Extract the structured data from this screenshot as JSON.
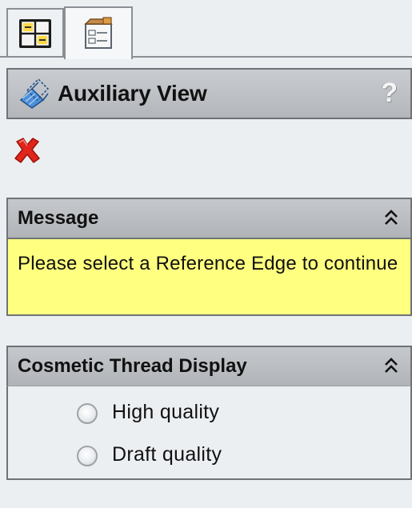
{
  "tabs": [
    {
      "icon": "feature-manager-icon"
    },
    {
      "icon": "property-manager-icon"
    }
  ],
  "property_manager": {
    "title": "Auxiliary View",
    "title_icon": "auxiliary-view-icon",
    "help_label": "?"
  },
  "actions": {
    "close_icon": "close-icon"
  },
  "message_group": {
    "header": "Message",
    "text": "Please select a Reference Edge to continue",
    "background": "#ffff80"
  },
  "cosmetic_thread_group": {
    "header": "Cosmetic Thread Display",
    "options": [
      {
        "label": "High quality",
        "selected": false
      },
      {
        "label": "Draft quality",
        "selected": false
      }
    ]
  },
  "colors": {
    "header_gradient_top": "#c9ccd0",
    "header_gradient_bottom": "#b3b6ba",
    "panel_background": "#eceff2",
    "close_red": "#e0261b"
  }
}
